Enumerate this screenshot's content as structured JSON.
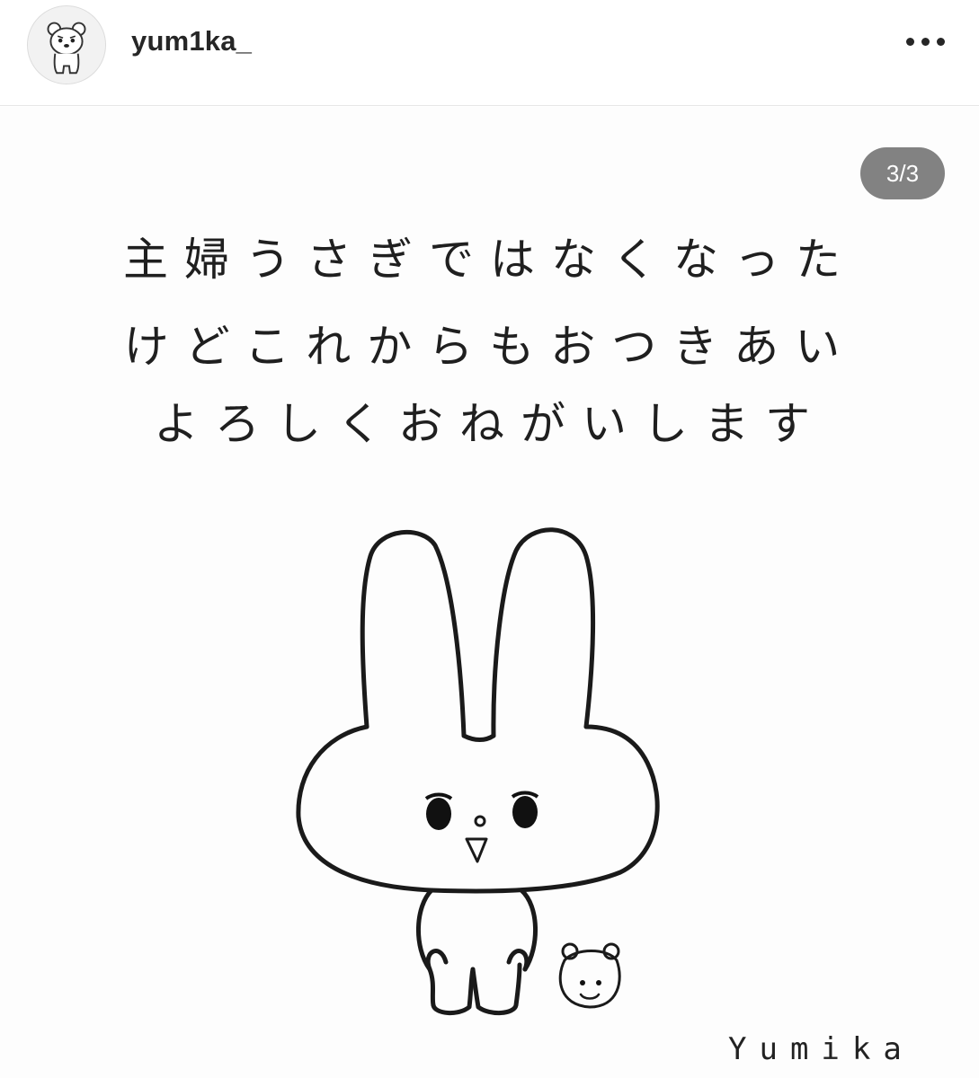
{
  "post": {
    "username": "yum1ka_",
    "slide_counter": "3/3",
    "image_text": {
      "line1": "主婦うさぎではなくなった",
      "line2": "けどこれからもおつきあい",
      "line3": "よろしくおねがいします"
    },
    "signature": "Yumika"
  },
  "icons": {
    "avatar": "bear-character-icon",
    "more": "more-options-icon"
  },
  "colors": {
    "username": "#262626",
    "counter_bg": "#828282",
    "ink": "#1f1f1f",
    "divider": "#e6e6e6"
  }
}
